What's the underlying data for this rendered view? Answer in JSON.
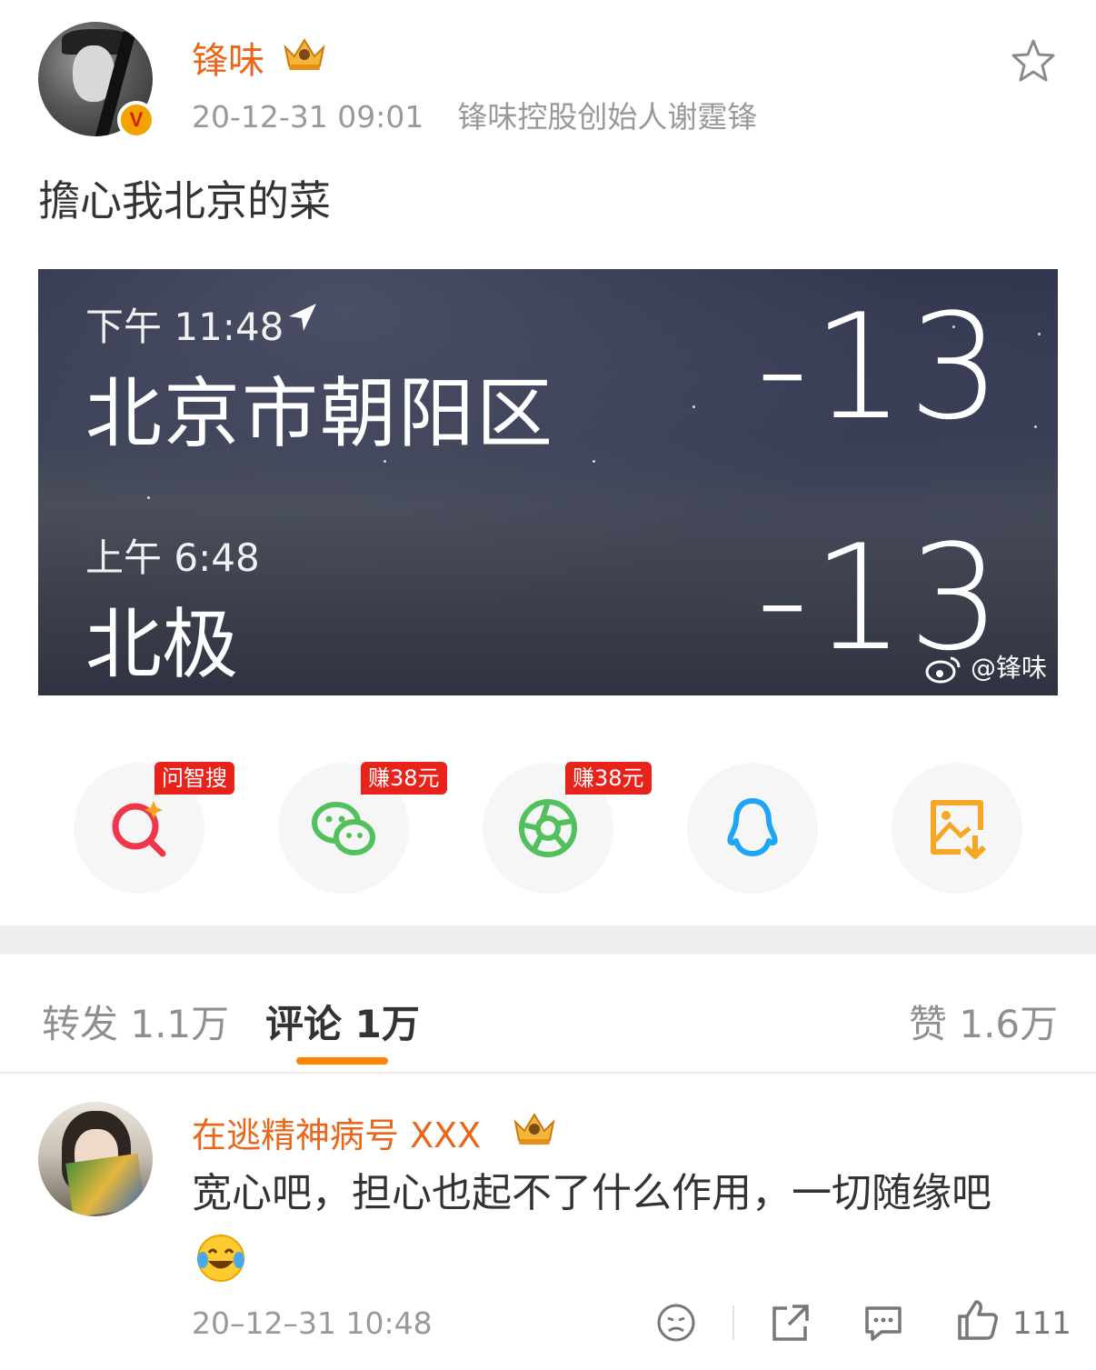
{
  "post": {
    "author": "锋味",
    "timestamp": "20-12-31 09:01",
    "source": "锋味控股创始人谢霆锋",
    "verified_badge": "V",
    "text": "擔心我北京的菜",
    "image": {
      "row1": {
        "time": "下午 11:48",
        "city": "北京市朝阳区",
        "temp": "-13"
      },
      "row2": {
        "time": "上午 6:48",
        "city": "北极",
        "temp": "-13"
      },
      "watermark": "@锋味"
    }
  },
  "share": [
    {
      "icon": "ai-search-icon",
      "tag": "问智搜",
      "color": "#f0364b"
    },
    {
      "icon": "wechat-icon",
      "tag": "赚38元",
      "color": "#52c05c"
    },
    {
      "icon": "moments-icon",
      "tag": "赚38元",
      "color": "#52c05c"
    },
    {
      "icon": "qq-icon",
      "tag": "",
      "color": "#1ea5f5"
    },
    {
      "icon": "save-image-icon",
      "tag": "",
      "color": "#f5a623"
    }
  ],
  "tabs": {
    "repost": "转发 1.1万",
    "comments": "评论 1万",
    "likes": "赞 1.6万"
  },
  "comment": {
    "author": "在逃精神病号 XXX",
    "text": "宽心吧，担心也起不了什么作用，一切随缘吧",
    "timestamp": "20–12–31 10:48",
    "like_count": "111"
  },
  "colors": {
    "accent": "#ff8200",
    "author_name": "#e8671b",
    "tag_red": "#e8231c"
  }
}
